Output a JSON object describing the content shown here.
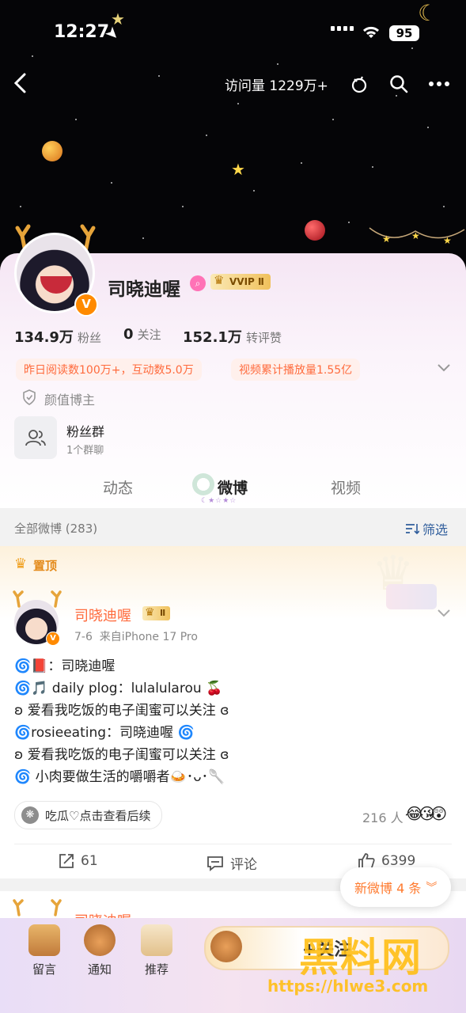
{
  "status_bar": {
    "time": "12:27",
    "battery": "95"
  },
  "header": {
    "visits": "访问量 1229万+"
  },
  "profile": {
    "name": "司晓迪喔",
    "vip_badge": "VVIP Ⅱ",
    "stats": [
      {
        "value": "134.9万",
        "label": "粉丝"
      },
      {
        "value": "0",
        "label": "关注"
      },
      {
        "value": "152.1万",
        "label": "转评赞"
      }
    ],
    "highlights": [
      "昨日阅读数100万+，互动数5.0万",
      "视频累计播放量1.55亿"
    ],
    "tag": "颜值博主",
    "fan_group": {
      "title": "粉丝群",
      "subtitle": "1个群聊"
    }
  },
  "tabs": [
    {
      "label": "动态",
      "active": false
    },
    {
      "label": "微博",
      "active": true
    },
    {
      "label": "视频",
      "active": false
    }
  ],
  "filter": {
    "all_label": "全部微博 (283)",
    "filter_label": "筛选"
  },
  "pinned_post": {
    "pin_label": "置顶",
    "author": "司晓迪喔",
    "author_badge": "Ⅱ",
    "meta": "7-6  来自iPhone 17 Pro",
    "lines": [
      "🌀📕：司晓迪喔",
      "🌀🎵 daily plog：lulalularou 🍒",
      "ʚ 爱看我吃饭的电子闺蜜可以关注 ɞ",
      "🌀rosieeating：司晓迪喔 🌀",
      "ʚ 爱看我吃饭的电子闺蜜可以关注 ɞ",
      "🌀 小肉要做生活的嚼嚼者🍛･ᴗ･🥄"
    ],
    "topic_chip": "吃瓜♡点击查看后续",
    "likes_count": "216 人",
    "actions": {
      "repost": "61",
      "comment": "评论",
      "like": "6399"
    }
  },
  "next_post": {
    "author": "司晓迪喔"
  },
  "new_posts_toast": "新微博 4 条",
  "bottom_nav": [
    {
      "label": "留言",
      "icon": "chair-icon"
    },
    {
      "label": "通知",
      "icon": "bear-icon"
    },
    {
      "label": "推荐",
      "icon": "gift-icon"
    }
  ],
  "follow_button": "+关注",
  "watermark": {
    "brand": "黑料网",
    "url": "https://hlwe3.com"
  },
  "colors": {
    "accent_orange": "#ff6b3d",
    "vip_gold": "#e0a21b",
    "verified": "#ff8a00",
    "link_blue": "#2f5d9c"
  }
}
